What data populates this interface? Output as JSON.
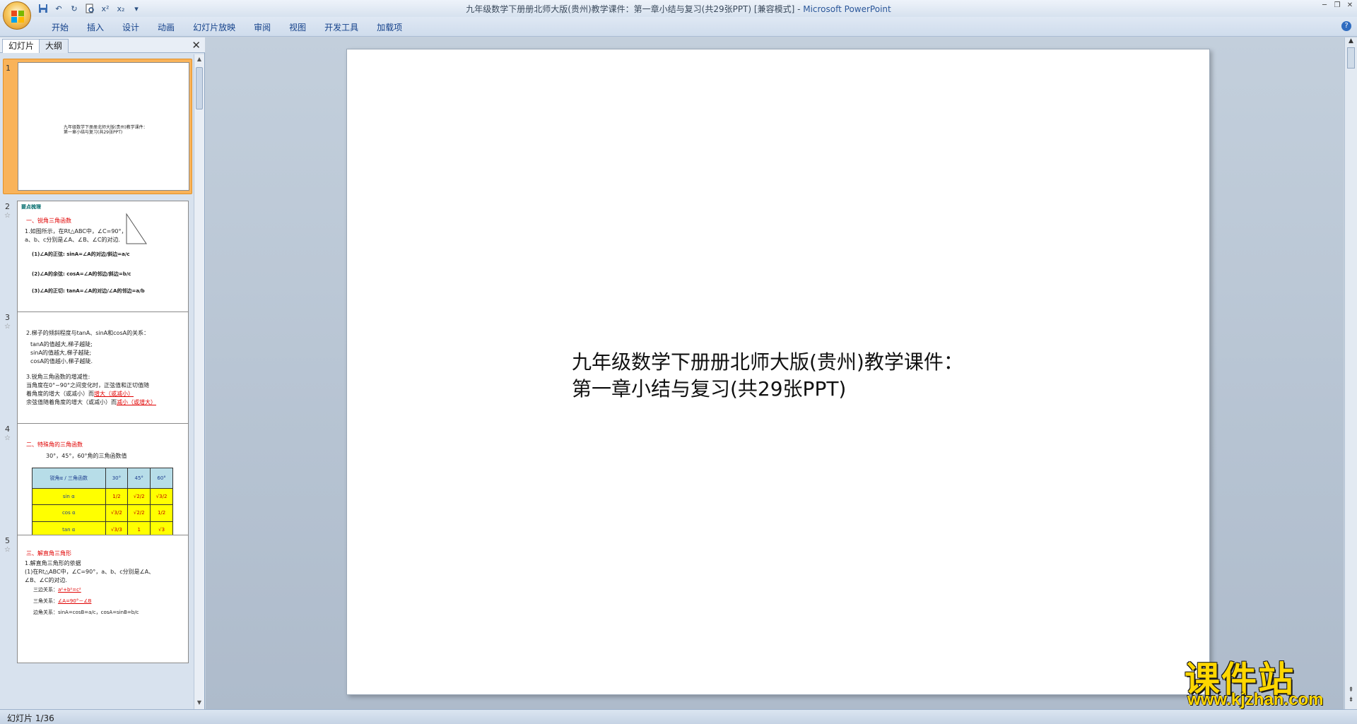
{
  "window": {
    "title": "九年级数学下册册北师大版(贵州)教学课件：第一章小结与复习(共29张PPT) [兼容模式]",
    "separator": " - ",
    "app": "Microsoft PowerPoint"
  },
  "qat": [
    "save-icon",
    "undo-icon",
    "redo-icon",
    "print-preview-icon",
    "superscript-icon",
    "subscript-icon",
    "customize-icon"
  ],
  "qat_glyphs": {
    "superscript": "x²",
    "subscript": "x₂",
    "customize": "▾"
  },
  "ribbon": {
    "tabs": [
      "开始",
      "插入",
      "设计",
      "动画",
      "幻灯片放映",
      "审阅",
      "视图",
      "开发工具",
      "加载项"
    ]
  },
  "left_pane": {
    "tab_slides": "幻灯片",
    "tab_outline": "大纲",
    "close": "✕"
  },
  "thumbnails": {
    "s1": {
      "num": "1",
      "line1": "九年级数学下册册北师大版(贵州)教学课件：",
      "line2": "第一章小结与复习(共29张PPT)"
    },
    "s2": {
      "num": "2",
      "heading": "要点梳理",
      "sec": "一、锐角三角函数",
      "l1": "1.如图所示，在Rt△ABC中，∠C=90°，",
      "l2": "a、b、c分别是∠A、∠B、∠C的对边.",
      "sin": "(1)∠A的正弦: sinA=∠A的对边/斜边=a/c",
      "cos": "(2)∠A的余弦: cosA=∠A的邻边/斜边=b/c",
      "tan": "(3)∠A的正切: tanA=∠A的对边/∠A的邻边=a/b"
    },
    "s3": {
      "num": "3",
      "l1": "2.梯子的倾斜程度与tanA、sinA和cosA的关系：",
      "l2": "tanA的值越大,梯子越陡;",
      "l3": "sinA的值越大,梯子越陡;",
      "l4": "cosA的值越小,梯子越陡.",
      "l5": "3.锐角三角函数的增减性:",
      "l6": "当角度在0°~90°之间变化时，正弦值和正切值随",
      "l7a": "着角度的增大（或减小）而",
      "l7b": "增大（或减小）",
      "l8a": "余弦值随着角度的增大（或减小）而",
      "l8b": "减小（或增大）"
    },
    "s4": {
      "num": "4",
      "sec": "二、特殊角的三角函数",
      "sub": "30°，45°，60°角的三角函数值",
      "table": {
        "header": [
          "锐角α / 三角函数",
          "30°",
          "45°",
          "60°"
        ],
        "rows": [
          [
            "sin α",
            "1/2",
            "√2/2",
            "√3/2"
          ],
          [
            "cos α",
            "√3/2",
            "√2/2",
            "1/2"
          ],
          [
            "tan α",
            "√3/3",
            "1",
            "√3"
          ]
        ]
      }
    },
    "s5": {
      "num": "5",
      "sec": "三、解直角三角形",
      "l1": "1.解直角三角形的依据",
      "l2": "(1)在Rt△ABC中，∠C=90°，a、b、c分别是∠A、",
      "l3": "∠B、∠C的对边.",
      "l4a": "三边关系：",
      "l4b": "a²+b²=c²",
      "l5a": "三角关系：",
      "l5b": "∠A=90°－∠B",
      "l6": "边角关系：sinA=cosB=a/c，cosA=sinB=b/c"
    }
  },
  "slide": {
    "line1": "九年级数学下册册北师大版(贵州)教学课件：",
    "line2": "第一章小结与复习(共29张PPT)"
  },
  "status": {
    "text": "幻灯片 1/36"
  },
  "watermark": {
    "big": "课件站",
    "small": "www.kjzhan.com"
  }
}
